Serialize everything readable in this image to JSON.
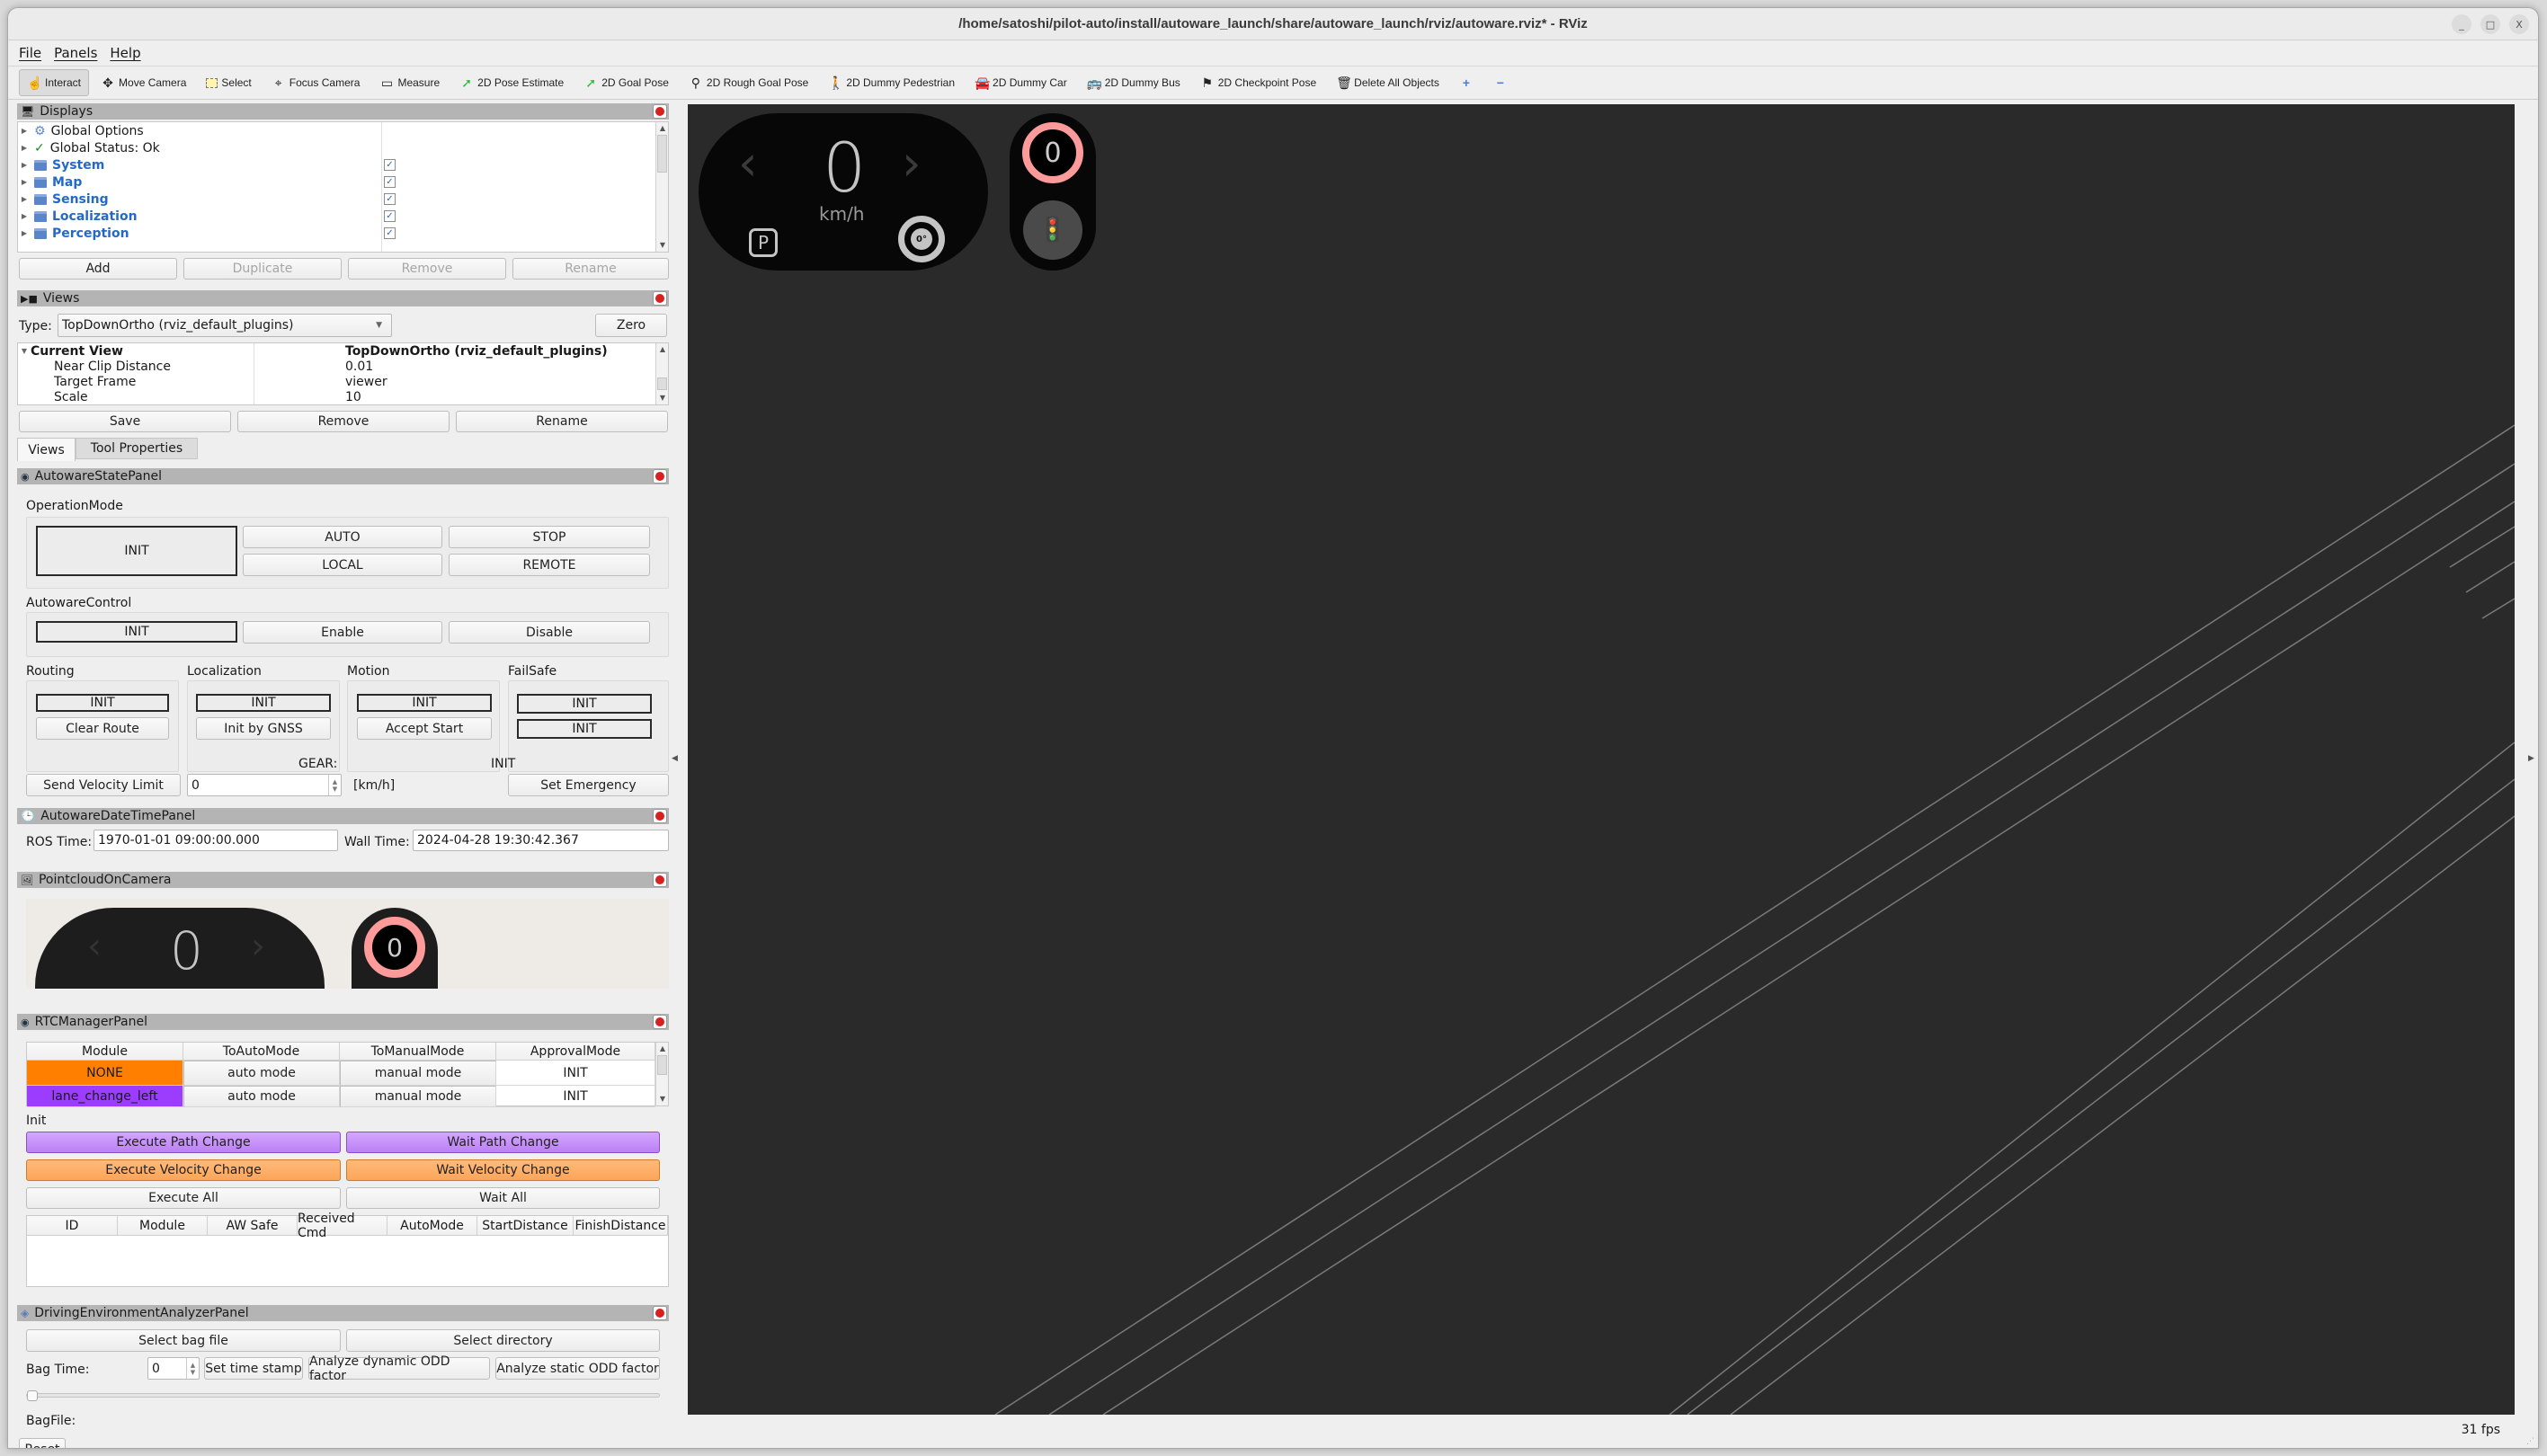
{
  "window": {
    "title": "/home/satoshi/pilot-auto/install/autoware_launch/share/autoware_launch/rviz/autoware.rviz* - RViz",
    "controls": {
      "minimize": "_",
      "maximize": "□",
      "close": "X"
    }
  },
  "menu": [
    "File",
    "Panels",
    "Help"
  ],
  "toolbar": [
    {
      "label": "Interact",
      "icon": "hand-pointer-icon",
      "active": true
    },
    {
      "label": "Move Camera",
      "icon": "move-camera-icon"
    },
    {
      "label": "Select",
      "icon": "select-box-icon"
    },
    {
      "label": "Focus Camera",
      "icon": "focus-camera-icon"
    },
    {
      "label": "Measure",
      "icon": "ruler-icon"
    },
    {
      "label": "2D Pose Estimate",
      "icon": "green-arrow-icon"
    },
    {
      "label": "2D Goal Pose",
      "icon": "green-arrow-icon"
    },
    {
      "label": "2D Rough Goal Pose",
      "icon": "map-pin-icon"
    },
    {
      "label": "2D Dummy Pedestrian",
      "icon": "pedestrian-icon"
    },
    {
      "label": "2D Dummy Car",
      "icon": "car-icon"
    },
    {
      "label": "2D Dummy Bus",
      "icon": "bus-icon"
    },
    {
      "label": "2D Checkpoint Pose",
      "icon": "flag-icon"
    },
    {
      "label": "Delete All Objects",
      "icon": "trash-icon"
    }
  ],
  "toolbar_extra": {
    "add": "+",
    "remove": "−"
  },
  "displays": {
    "title": "Displays",
    "items": [
      {
        "label": "Global Options",
        "icon": "gear-icon",
        "style": "normal"
      },
      {
        "label": "Global Status: Ok",
        "icon": "checkmark-icon",
        "style": "normal"
      },
      {
        "label": "System",
        "checked": true,
        "style": "folder"
      },
      {
        "label": "Map",
        "checked": true,
        "style": "folder"
      },
      {
        "label": "Sensing",
        "checked": true,
        "style": "folder"
      },
      {
        "label": "Localization",
        "checked": true,
        "style": "folder"
      },
      {
        "label": "Perception",
        "checked": true,
        "style": "folder"
      }
    ],
    "buttons": {
      "add": "Add",
      "duplicate": "Duplicate",
      "remove": "Remove",
      "rename": "Rename"
    }
  },
  "views": {
    "title": "Views",
    "type_label": "Type:",
    "type_value": "TopDownOrtho (rviz_default_plugins)",
    "zero": "Zero",
    "current_view": {
      "label": "Current View",
      "value": "TopDownOrtho (rviz_default_plugins)"
    },
    "props": [
      {
        "name": "Near Clip Distance",
        "value": "0.01"
      },
      {
        "name": "Target Frame",
        "value": "viewer"
      },
      {
        "name": "Scale",
        "value": "10"
      }
    ],
    "buttons": {
      "save": "Save",
      "remove": "Remove",
      "rename": "Rename"
    },
    "tabs": [
      "Views",
      "Tool Properties"
    ]
  },
  "state_panel": {
    "title": "AutowareStatePanel",
    "operation_mode_label": "OperationMode",
    "operation_mode_state": "INIT",
    "operation_buttons": [
      "AUTO",
      "STOP",
      "LOCAL",
      "REMOTE"
    ],
    "control_label": "AutowareControl",
    "control_state": "INIT",
    "control_buttons": [
      "Enable",
      "Disable"
    ],
    "routing": {
      "label": "Routing",
      "state": "INIT",
      "button": "Clear Route"
    },
    "localization": {
      "label": "Localization",
      "state": "INIT",
      "button": "Init by GNSS"
    },
    "motion": {
      "label": "Motion",
      "state": "INIT",
      "button": "Accept Start"
    },
    "failsafe": {
      "label": "FailSafe",
      "state1": "INIT",
      "state2": "INIT"
    },
    "gear_label": "GEAR:",
    "gear_value": "INIT",
    "send_velocity": "Send Velocity Limit",
    "velocity_value": "0",
    "velocity_unit": "[km/h]",
    "set_emergency": "Set Emergency"
  },
  "datetime_panel": {
    "title": "AutowareDateTimePanel",
    "ros_label": "ROS Time:",
    "ros_value": "1970-01-01 09:00:00.000",
    "wall_label": "Wall Time:",
    "wall_value": "2024-04-28 19:30:42.367"
  },
  "pointcloud_panel": {
    "title": "PointcloudOnCamera"
  },
  "rtc_panel": {
    "title": "RTCManagerPanel",
    "columns": [
      "Module",
      "ToAutoMode",
      "ToManualMode",
      "ApprovalMode"
    ],
    "rows": [
      {
        "module": "NONE",
        "color": "#ff8000",
        "to_auto": "auto mode",
        "to_manual": "manual mode",
        "approval": "INIT"
      },
      {
        "module": "lane_change_left",
        "color": "#9b3cff",
        "to_auto": "auto mode",
        "to_manual": "manual mode",
        "approval": "INIT"
      }
    ],
    "status": "Init",
    "buttons": {
      "execute_path": "Execute Path Change",
      "wait_path": "Wait Path Change",
      "execute_velocity": "Execute Velocity Change",
      "wait_velocity": "Wait Velocity Change",
      "execute_all": "Execute All",
      "wait_all": "Wait All"
    },
    "colors": {
      "purple": "#bb80f5",
      "orange": "#fca55a"
    },
    "cmd_columns": [
      "ID",
      "Module",
      "AW Safe",
      "Received Cmd",
      "AutoMode",
      "StartDistance",
      "FinishDistance"
    ]
  },
  "driving_panel": {
    "title": "DrivingEnvironmentAnalyzerPanel",
    "select_bag": "Select bag file",
    "select_dir": "Select directory",
    "bag_time_label": "Bag Time:",
    "bag_time_value": "0",
    "set_timestamp": "Set time stamp",
    "analyze_dynamic": "Analyze dynamic ODD factor",
    "analyze_static": "Analyze static ODD factor",
    "slider_value": 0,
    "bagfile_label": "BagFile:",
    "reset": "Reset"
  },
  "hud": {
    "speed": "0",
    "speed_unit": "km/h",
    "gear": "P",
    "steering": "0°",
    "speed_limit": "0",
    "ring_color": "#ff9a9a"
  },
  "status": {
    "fps": "31 fps"
  }
}
